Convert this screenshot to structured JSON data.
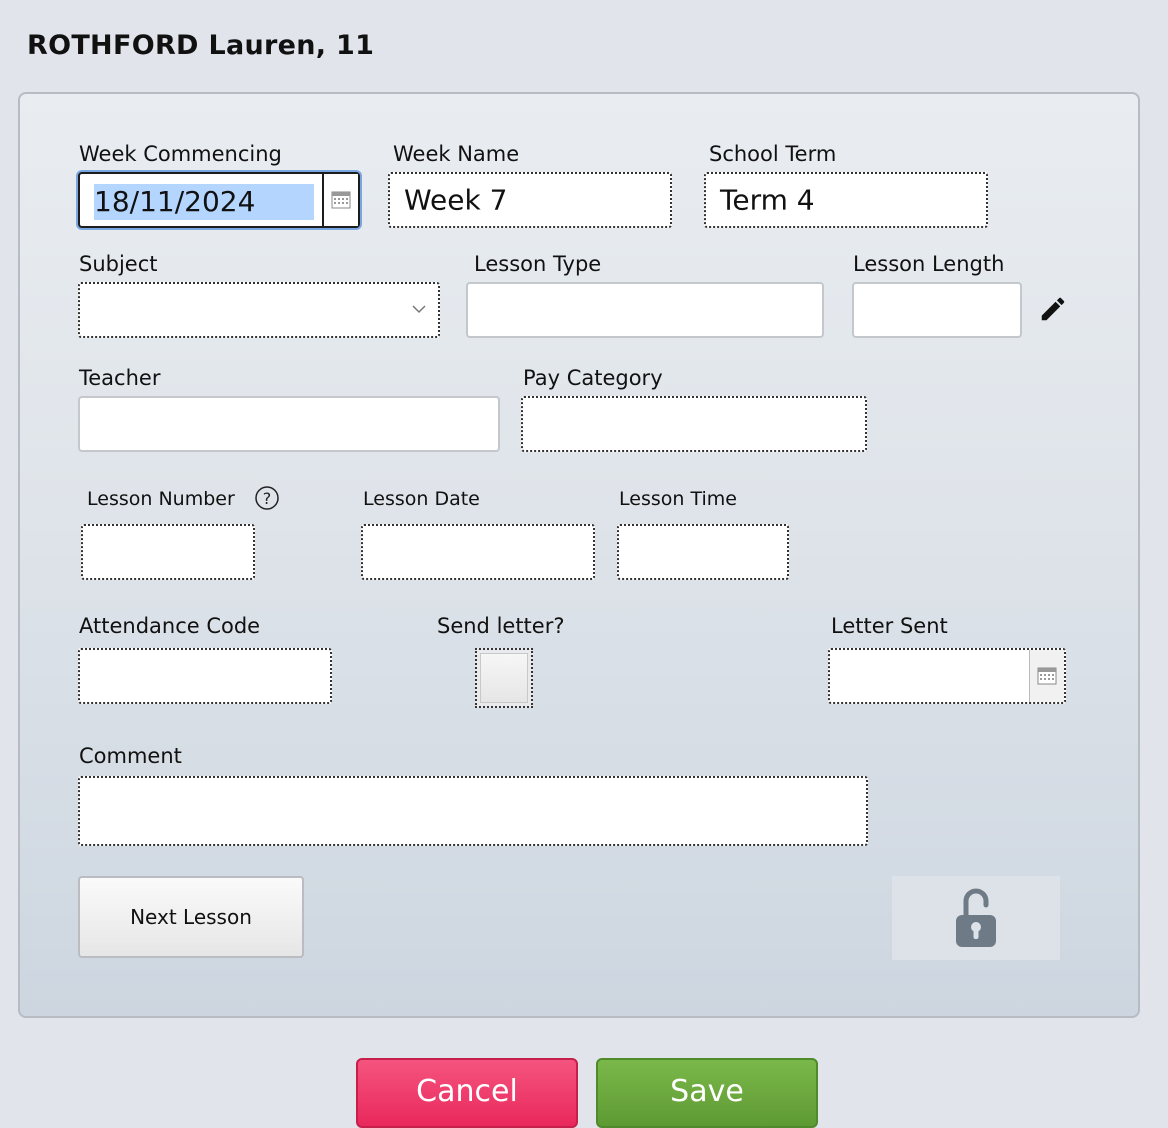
{
  "record_title": "ROTHFORD Lauren, 11",
  "form": {
    "week_commencing": {
      "label": "Week Commencing",
      "value": "18/11/2024"
    },
    "week_name": {
      "label": "Week Name",
      "value": "Week 7"
    },
    "school_term": {
      "label": "School Term",
      "value": "Term 4"
    },
    "subject": {
      "label": "Subject",
      "value": ""
    },
    "lesson_type": {
      "label": "Lesson Type",
      "value": ""
    },
    "lesson_length": {
      "label": "Lesson Length",
      "value": ""
    },
    "teacher": {
      "label": "Teacher",
      "value": ""
    },
    "pay_category": {
      "label": "Pay Category",
      "value": ""
    },
    "lesson_number": {
      "label": "Lesson Number",
      "value": ""
    },
    "lesson_date": {
      "label": "Lesson Date",
      "value": ""
    },
    "lesson_time": {
      "label": "Lesson Time",
      "value": ""
    },
    "attendance_code": {
      "label": "Attendance Code",
      "value": ""
    },
    "send_letter": {
      "label": "Send letter?",
      "checked": false
    },
    "letter_sent": {
      "label": "Letter Sent",
      "value": ""
    },
    "comment": {
      "label": "Comment",
      "value": ""
    }
  },
  "buttons": {
    "next_lesson": "Next Lesson",
    "cancel": "Cancel",
    "save": "Save"
  },
  "icons": {
    "calendar": "calendar-icon",
    "dropdown": "chevron-down-icon",
    "edit": "pencil-icon",
    "help": "question-icon",
    "lock": "unlocked-padlock-icon"
  },
  "colors": {
    "cancel": "#ee3a68",
    "save": "#6aa83d",
    "selection": "#b4d5fe",
    "lock": "#6e7a86"
  }
}
